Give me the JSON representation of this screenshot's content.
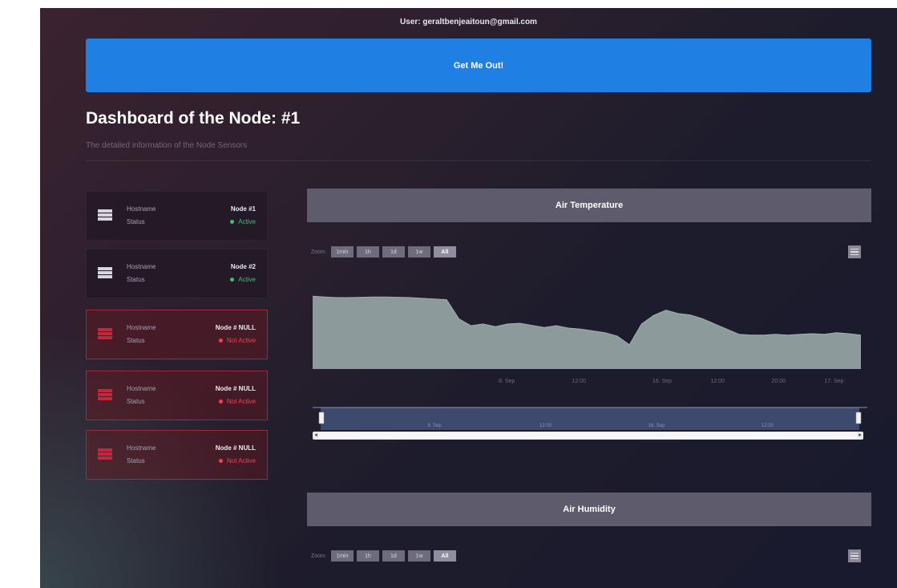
{
  "user_line": "User: geraltbenjeaitoun@gmail.com",
  "exit_button": "Get Me Out!",
  "page": {
    "title": "Dashboard of the Node: #1",
    "subtitle": "The detailed information of the Node Sensors"
  },
  "nodes": [
    {
      "hostname_label": "Hostname",
      "hostname": "Node #1",
      "status_label": "Status",
      "status": "Active",
      "state": "active"
    },
    {
      "hostname_label": "Hostname",
      "hostname": "Node #2",
      "status_label": "Status",
      "status": "Active",
      "state": "active"
    },
    {
      "hostname_label": "Hostname",
      "hostname": "Node # NULL",
      "status_label": "Status",
      "status": "Not Active",
      "state": "inactive"
    },
    {
      "hostname_label": "Hostname",
      "hostname": "Node # NULL",
      "status_label": "Status",
      "status": "Not Active",
      "state": "inactive"
    },
    {
      "hostname_label": "Hostname",
      "hostname": "Node # NULL",
      "status_label": "Status",
      "status": "Not Active",
      "state": "inactive"
    }
  ],
  "zoom": {
    "label": "Zoom",
    "buttons": [
      "1min",
      "1h",
      "1d",
      "1w",
      "All"
    ],
    "active": "All"
  },
  "panels": [
    {
      "title": "Air Temperature"
    },
    {
      "title": "Air Humidity"
    }
  ],
  "colors": {
    "accent": "#1f7fe3",
    "active": "#36c46b",
    "inactive": "#ff3b50",
    "chart_area": "#8c9a9c",
    "navigator": "#3d4a6e"
  },
  "chart_data": {
    "type": "area",
    "title": "Air Temperature",
    "x_tick_labels": [
      "8. Sep",
      "12:00",
      "16. Sep",
      "12:00",
      "20:00",
      "17. Sep"
    ],
    "navigator_tick_labels": [
      "8. Sep",
      "12:00",
      "16. Sep",
      "12:00"
    ],
    "values": [
      31,
      30.8,
      30.6,
      30.6,
      30.7,
      30.8,
      30.8,
      30.7,
      30.6,
      30.4,
      30.2,
      30,
      24.5,
      22.5,
      23,
      22.2,
      23,
      23.2,
      22.6,
      22,
      22.5,
      21.8,
      21.5,
      21,
      20.5,
      19.5,
      17,
      23,
      25.5,
      27,
      26,
      25.6,
      24.5,
      23,
      21.5,
      20,
      19.8,
      19.8,
      20,
      19.8,
      20,
      20.2,
      20,
      20.5,
      20.2,
      19.8
    ],
    "ylim": [
      0,
      40
    ],
    "grid": false,
    "legend": false
  }
}
